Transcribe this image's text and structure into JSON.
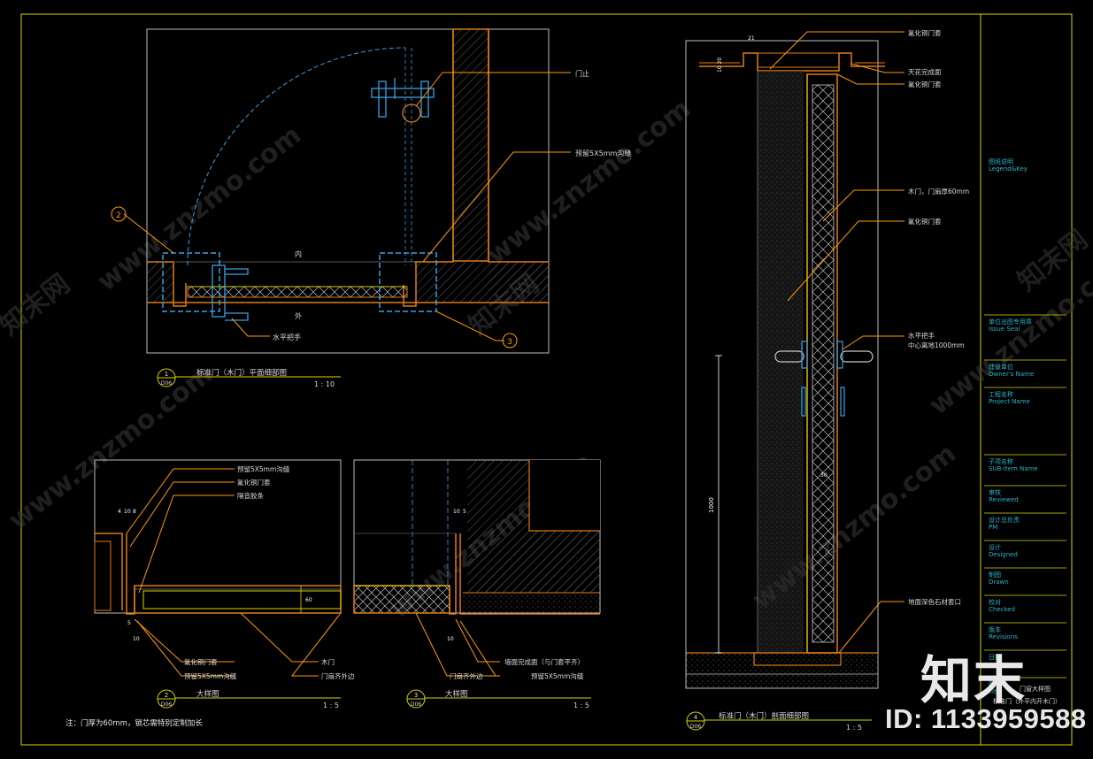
{
  "plan": {
    "label_door_stop": "门止",
    "label_groove": "预留5X5mm沟缝",
    "label_inside": "内",
    "label_outside": "外",
    "label_handle": "水平把手",
    "callout_2": "2",
    "callout_3": "3",
    "title_no": "1",
    "title_sheet": "D06",
    "title": "标准门（木门）平面细部图",
    "scale": "1 : 10"
  },
  "detail2": {
    "leader_groove": "预留5X5mm沟缝",
    "leader_frame": "氟化铜门套",
    "leader_strip": "隔音胶条",
    "dim_4": "4",
    "dim_10": "10",
    "dim_8": "8",
    "dim_60": "60",
    "dim_b5": "5",
    "dim_b10": "10",
    "bot_frame": "氟化铜门套",
    "bot_groove": "预留5X5mm沟缝",
    "bot_wood": "木门",
    "bot_edge": "门扇齐外边",
    "title_no": "2",
    "title_sheet": "D06",
    "title": "大样图",
    "scale": "1 : 5"
  },
  "detail3": {
    "dim_10": "10",
    "dim_5": "5",
    "dim_b10": "10",
    "bot_edge": "门扇齐外边",
    "bot_wall": "墙面完成面（与门套平齐）",
    "bot_groove": "预留5X5mm沟缝",
    "title_no": "3",
    "title_sheet": "D06",
    "title": "大样图",
    "scale": "1 : 5"
  },
  "section": {
    "dim_21": "21",
    "dim_side": "10 20",
    "label_frame_top": "氟化铜门套",
    "label_ceiling": "天花完成面",
    "label_frame_2": "氟化铜门套",
    "label_door": "木门，门扇厚60mm",
    "label_frame_3": "氟化铜门套",
    "label_handle": "水平把手",
    "label_handle_h": "中心离地1000mm",
    "dim_1000": "1000",
    "dim_30": "30",
    "label_stone": "地面深色石材套口",
    "title_no": "4",
    "title_sheet": "D06",
    "title": "标准门（木门）剖面细部图",
    "scale": "1 : 5"
  },
  "note": "注：门厚为60mm，锁芯需特别定制加长",
  "titleblock": {
    "legend": "图纸说明",
    "legend_en": "Legend&Key",
    "issue": "单位出图专用章",
    "issue_en": "Issue Seal",
    "owner": "建设单位",
    "owner_en": "Owner's Name",
    "project": "工程名称",
    "project_en": "Project Name",
    "subitem": "子项名称",
    "subitem_en": "SUB-Item Name",
    "reviewed": "审核",
    "reviewed_en": "Reviewed",
    "pm": "设计总负责",
    "pm_en": "PM",
    "designed": "设计",
    "designed_en": "Designed",
    "drawn": "制图",
    "drawn_en": "Drawn",
    "checked": "校对",
    "checked_en": "Checked",
    "revisions": "版本",
    "revisions_en": "Revisions",
    "date": "日期",
    "title_cn": "图名",
    "title_en": "Title",
    "title_val": "门窗大样图",
    "title_val2": "标准门（外平内开木门）"
  },
  "watermark": {
    "text": "www.znzmo.com",
    "brand": "知末网",
    "logo": "知末",
    "id": "ID: 1133959588"
  },
  "colors": {
    "frame": "#d8d400",
    "wall": "#e07a18",
    "door": "#c8c8c8",
    "leader": "#ff9a00",
    "dash": "#3aa0e0",
    "text": "#d8d8d8",
    "tb_text": "#2bb3c8"
  }
}
